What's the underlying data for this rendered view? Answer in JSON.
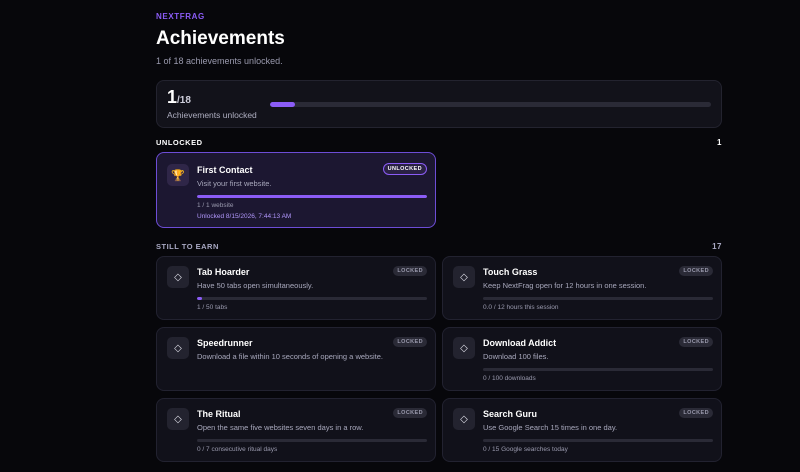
{
  "header": {
    "brand": "NEXTFRAG",
    "title": "Achievements",
    "subtitle": "1 of 18 achievements unlocked."
  },
  "summary": {
    "count": "1",
    "total": "/18",
    "label": "Achievements unlocked",
    "progress_fraction": 0.0556
  },
  "sections": {
    "unlocked": {
      "label": "UNLOCKED",
      "count": "1"
    },
    "locked": {
      "label": "STILL TO EARN",
      "count": "17"
    }
  },
  "unlocked_items": [
    {
      "title": "First Contact",
      "desc": "Visit your first website.",
      "badge": "UNLOCKED",
      "progress_text": "1 / 1 website",
      "date": "Unlocked 8/15/2026, 7:44:13 AM",
      "progress_fraction": 1,
      "icon": "trophy-icon",
      "icon_glyph": "🏆"
    }
  ],
  "locked_items": [
    {
      "title": "Tab Hoarder",
      "desc": "Have 50 tabs open simultaneously.",
      "badge": "LOCKED",
      "progress_text": "1 / 50 tabs",
      "progress_fraction": 0.02,
      "icon": "diamond-icon",
      "icon_glyph": "◇"
    },
    {
      "title": "Touch Grass",
      "desc": "Keep NextFrag open for 12 hours in one session.",
      "badge": "LOCKED",
      "progress_text": "0.0 / 12 hours this session",
      "progress_fraction": 0,
      "icon": "diamond-icon",
      "icon_glyph": "◇"
    },
    {
      "title": "Speedrunner",
      "desc": "Download a file within 10 seconds of opening a website.",
      "badge": "LOCKED",
      "progress_text": "",
      "progress_fraction": null,
      "icon": "diamond-icon",
      "icon_glyph": "◇"
    },
    {
      "title": "Download Addict",
      "desc": "Download 100 files.",
      "badge": "LOCKED",
      "progress_text": "0 / 100 downloads",
      "progress_fraction": 0,
      "icon": "diamond-icon",
      "icon_glyph": "◇"
    },
    {
      "title": "The Ritual",
      "desc": "Open the same five websites seven days in a row.",
      "badge": "LOCKED",
      "progress_text": "0 / 7 consecutive ritual days",
      "progress_fraction": 0,
      "icon": "diamond-icon",
      "icon_glyph": "◇"
    },
    {
      "title": "Search Guru",
      "desc": "Use Google Search 15 times in one day.",
      "badge": "LOCKED",
      "progress_text": "0 / 15 Google searches today",
      "progress_fraction": 0,
      "icon": "diamond-icon",
      "icon_glyph": "◇"
    }
  ]
}
